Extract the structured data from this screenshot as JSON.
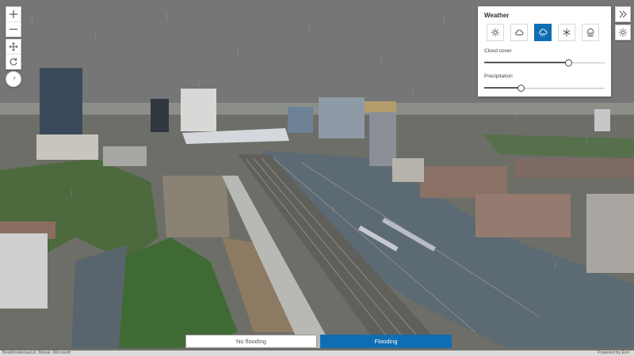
{
  "weather": {
    "title": "Weather",
    "icons": [
      {
        "name": "sunny-icon",
        "selected": false
      },
      {
        "name": "cloudy-icon",
        "selected": false
      },
      {
        "name": "rainy-icon",
        "selected": true
      },
      {
        "name": "snowy-icon",
        "selected": false
      },
      {
        "name": "foggy-icon",
        "selected": false
      }
    ],
    "cloud_cover": {
      "label": "Cloud cover",
      "value": 0.7
    },
    "precipitation": {
      "label": "Precipitation",
      "value": 0.3
    }
  },
  "flood_toggle": {
    "no_flooding_label": "No flooding",
    "flooding_label": "Flooding",
    "active": "Flooding"
  },
  "attribution": {
    "left": "Beeldmateriaal.nl, Maxar, Microsoft",
    "right": "Powered by Esri"
  },
  "colors": {
    "accent": "#0f6db3",
    "water": "#5c6a74",
    "sky": "#767676"
  }
}
